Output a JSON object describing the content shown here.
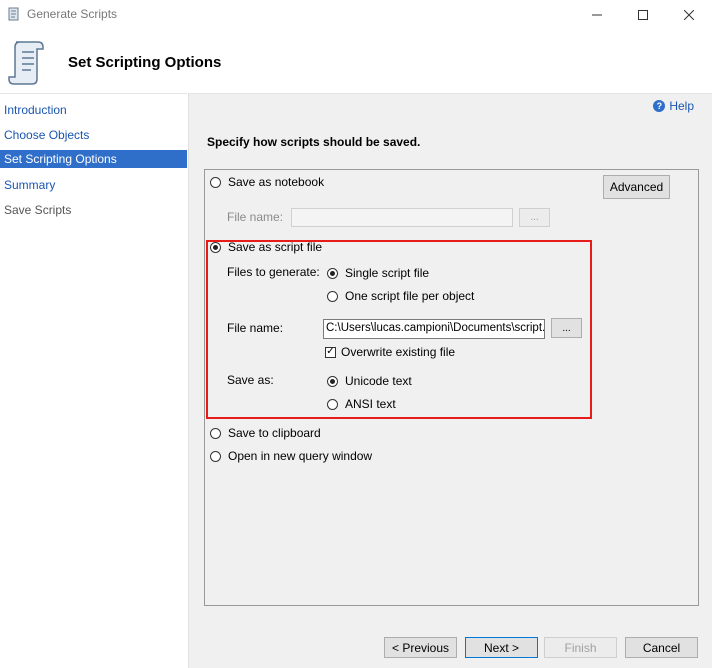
{
  "window": {
    "title": "Generate Scripts"
  },
  "header": {
    "title": "Set Scripting Options"
  },
  "nav": {
    "items": [
      {
        "label": "Introduction"
      },
      {
        "label": "Choose Objects"
      },
      {
        "label": "Set Scripting Options"
      },
      {
        "label": "Summary"
      },
      {
        "label": "Save Scripts"
      }
    ],
    "active_index": 2
  },
  "help": {
    "label": "Help"
  },
  "instruction": "Specify how scripts should be saved.",
  "options": {
    "notebook": {
      "label": "Save as notebook",
      "selected": false,
      "file_name_label": "File name:",
      "file_name_value": "",
      "browse_label": "..."
    },
    "advanced_label": "Advanced",
    "script_file": {
      "label": "Save as script file",
      "selected": true,
      "files_to_generate_label": "Files to generate:",
      "single_label": "Single script file",
      "single_selected": true,
      "per_object_label": "One script file per object",
      "per_object_selected": false,
      "file_name_label": "File name:",
      "file_name_value": "C:\\Users\\lucas.campioni\\Documents\\script.sql",
      "browse_label": "...",
      "overwrite_label": "Overwrite existing file",
      "overwrite_checked": true,
      "save_as_label": "Save as:",
      "unicode_label": "Unicode text",
      "unicode_selected": true,
      "ansi_label": "ANSI text",
      "ansi_selected": false
    },
    "clipboard": {
      "label": "Save to clipboard",
      "selected": false
    },
    "query_window": {
      "label": "Open in new query window",
      "selected": false
    }
  },
  "footer": {
    "previous_label": "< Previous",
    "next_label": "Next >",
    "finish_label": "Finish",
    "cancel_label": "Cancel"
  },
  "colors": {
    "accent": "#2f6ec9",
    "highlight": "#e81b1b",
    "link": "#1a56b0"
  }
}
